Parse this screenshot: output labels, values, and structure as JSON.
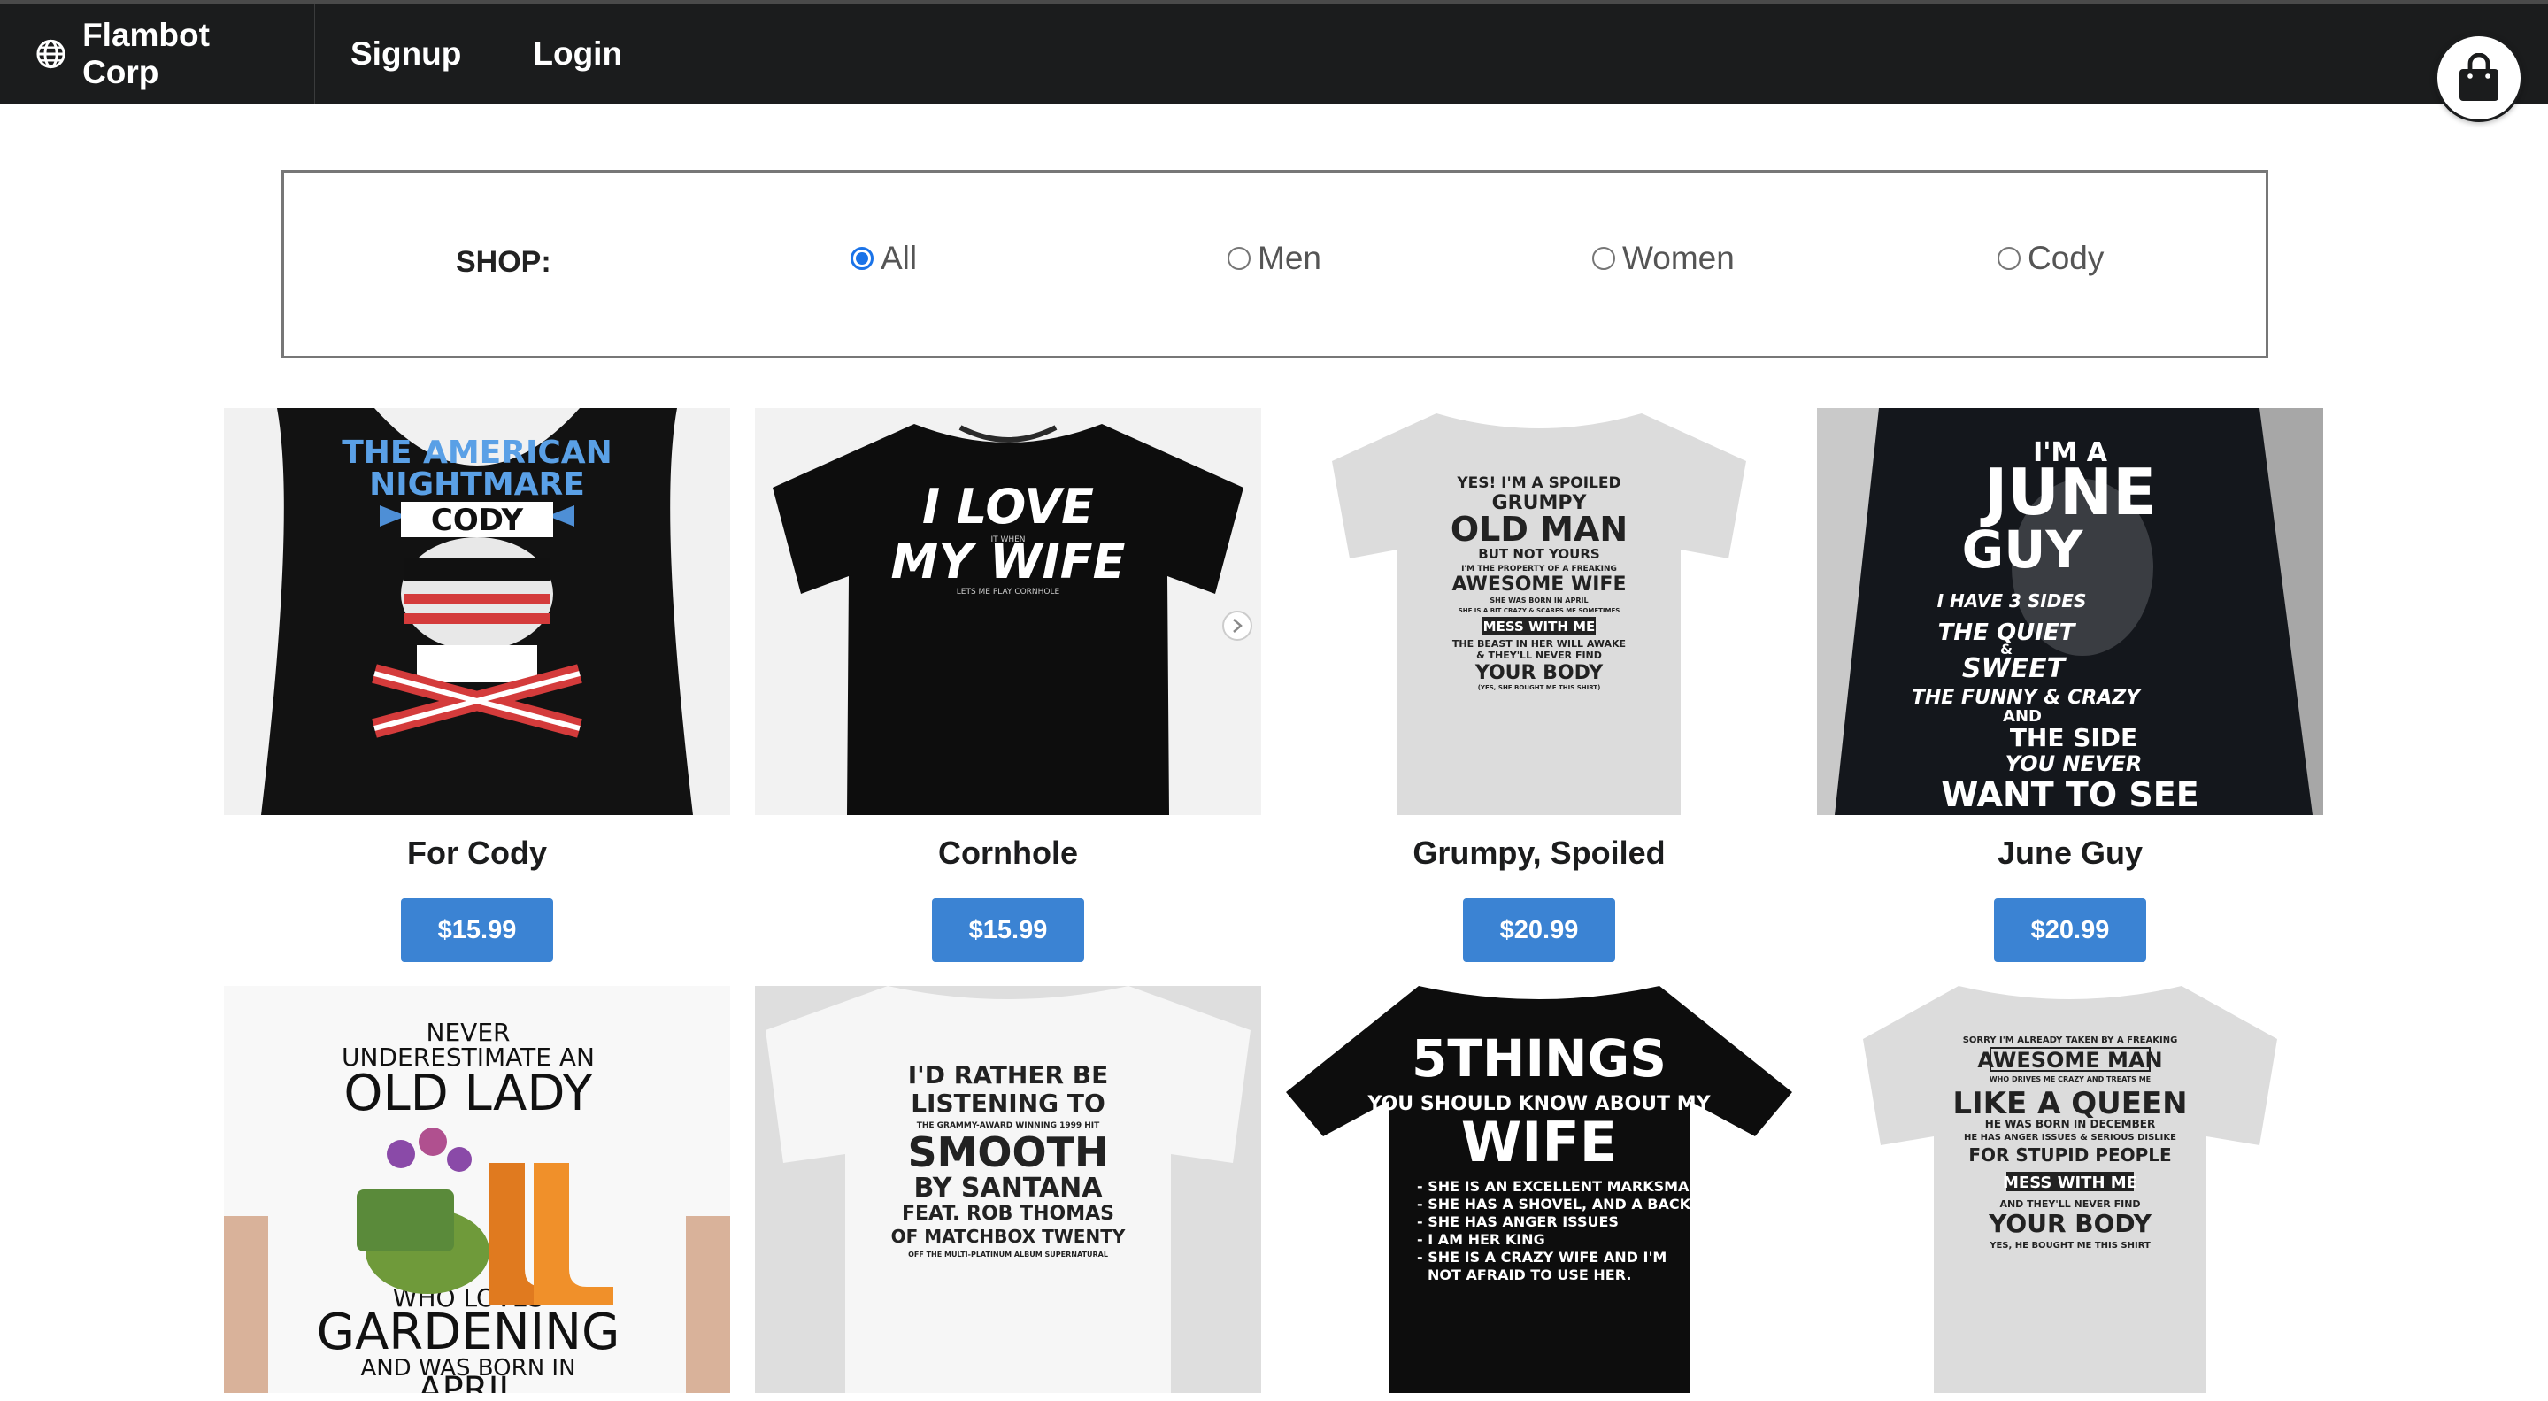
{
  "navbar": {
    "brand": "Flambot Corp",
    "links": [
      "Signup",
      "Login"
    ],
    "brand_icon": "globe-icon",
    "cart_icon": "shopping-bag-icon"
  },
  "filter": {
    "label": "SHOP:",
    "options": [
      {
        "label": "All",
        "checked": true
      },
      {
        "label": "Men",
        "checked": false
      },
      {
        "label": "Women",
        "checked": false
      },
      {
        "label": "Cody",
        "checked": false
      }
    ]
  },
  "products": [
    {
      "name": "For Cody",
      "price": "$15.99",
      "print": [
        "THE AMERICAN",
        "NIGHTMARE",
        "CODY"
      ]
    },
    {
      "name": "Cornhole",
      "price": "$15.99",
      "print": [
        "I LOVE",
        "IT WHEN",
        "MY WIFE",
        "LETS ME PLAY CORNHOLE"
      ]
    },
    {
      "name": "Grumpy, Spoiled",
      "price": "$20.99",
      "print": [
        "YES! I'M A SPOILED",
        "GRUMPY",
        "OLD MAN",
        "BUT NOT YOURS",
        "I'M THE PROPERTY OF A FREAKING",
        "AWESOME WIFE",
        "SHE WAS BORN IN APRIL",
        "SHE IS A BIT CRAZY & SCARES ME SOMETIMES",
        "MESS WITH ME",
        "THE BEAST IN HER WILL AWAKE",
        "& THEY'LL NEVER FIND",
        "YOUR BODY",
        "(YES, SHE BOUGHT ME THIS SHIRT)"
      ]
    },
    {
      "name": "June Guy",
      "price": "$20.99",
      "print": [
        "I'M A",
        "JUNE",
        "GUY",
        "I HAVE 3 SIDES",
        "THE QUIET",
        "&",
        "SWEET",
        "THE FUNNY & CRAZY",
        "AND",
        "THE SIDE",
        "YOU NEVER",
        "WANT TO SEE"
      ]
    },
    {
      "name": "",
      "price": "",
      "print": [
        "NEVER",
        "UNDERESTIMATE AN",
        "OLD LADY",
        "WHO LOVES",
        "GARDENING",
        "AND WAS BORN IN",
        "APRIL"
      ]
    },
    {
      "name": "",
      "price": "",
      "print": [
        "I'D RATHER BE",
        "LISTENING TO",
        "THE GRAMMY-AWARD WINNING 1999 HIT",
        "SMOOTH",
        "BY SANTANA",
        "FEAT. ROB THOMAS",
        "OF MATCHBOX TWENTY",
        "OFF THE MULTI-PLATINUM ALBUM SUPERNATURAL"
      ]
    },
    {
      "name": "",
      "price": "",
      "print": [
        "5THINGS",
        "YOU SHOULD KNOW ABOUT MY",
        "WIFE",
        "- SHE IS AN EXCELLENT MARKSMAN",
        "- SHE HAS A SHOVEL, AND A BACKYARD",
        "- SHE HAS ANGER ISSUES",
        "- I AM HER KING",
        "- SHE IS A CRAZY WIFE AND I'M",
        "NOT AFRAID TO USE HER."
      ]
    },
    {
      "name": "",
      "price": "",
      "print": [
        "SORRY I'M ALREADY TAKEN BY A FREAKING",
        "AWESOME MAN",
        "WHO DRIVES ME CRAZY AND TREATS ME",
        "LIKE A QUEEN",
        "HE WAS BORN IN DECEMBER",
        "HE HAS ANGER ISSUES & SERIOUS DISLIKE",
        "FOR STUPID PEOPLE",
        "MESS WITH ME",
        "AND THEY'LL NEVER FIND",
        "YOUR BODY",
        "YES, HE BOUGHT ME THIS SHIRT"
      ]
    }
  ]
}
